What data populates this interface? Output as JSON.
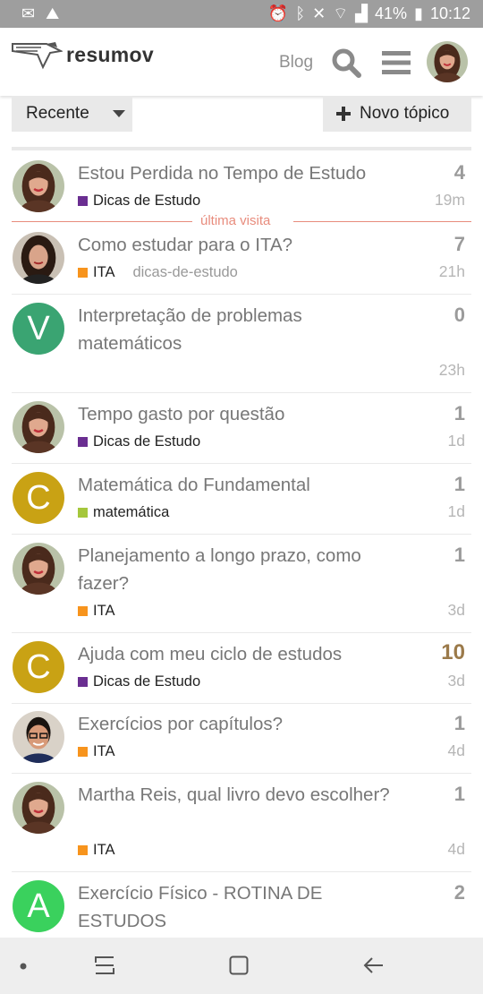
{
  "status": {
    "battery": "41%",
    "time": "10:12"
  },
  "header": {
    "logo": "resumov",
    "blog": "Blog"
  },
  "controls": {
    "filter": "Recente",
    "new_topic": "Novo tópico"
  },
  "last_visit_label": "última visita",
  "colors": {
    "dicas": "#6a2e91",
    "ita": "#f7941d",
    "matematica": "#a5c73c",
    "avatar_v": "#3aa472",
    "avatar_c": "#c9a214",
    "avatar_a": "#3ad15d",
    "hot_count": "#9b7a4a"
  },
  "topics": [
    {
      "title": "Estou Perdida no Tempo de Estudo",
      "category": "Dicas de Estudo",
      "count": "4",
      "age": "19m"
    },
    {
      "title": "Como estudar para o ITA?",
      "category": "ITA",
      "tag": "dicas-de-estudo",
      "count": "7",
      "age": "21h"
    },
    {
      "title": "Interpretação de problemas matemáticos",
      "letter": "V",
      "count": "0",
      "age": "23h"
    },
    {
      "title": "Tempo gasto por questão",
      "category": "Dicas de Estudo",
      "count": "1",
      "age": "1d"
    },
    {
      "title": "Matemática do Fundamental",
      "letter": "C",
      "category": "matemática",
      "count": "1",
      "age": "1d"
    },
    {
      "title": "Planejamento a longo prazo, como fazer?",
      "category": "ITA",
      "count": "1",
      "age": "3d"
    },
    {
      "title": "Ajuda com meu ciclo de estudos",
      "letter": "C",
      "category": "Dicas de Estudo",
      "count": "10",
      "age": "3d"
    },
    {
      "title": "Exercícios por capítulos?",
      "category": "ITA",
      "count": "1",
      "age": "4d"
    },
    {
      "title": "Martha Reis, qual livro devo escolher?",
      "category": "ITA",
      "count": "1",
      "age": "4d"
    },
    {
      "title": "Exercício Físico - ROTINA DE ESTUDOS",
      "letter": "A",
      "count": "2"
    }
  ]
}
